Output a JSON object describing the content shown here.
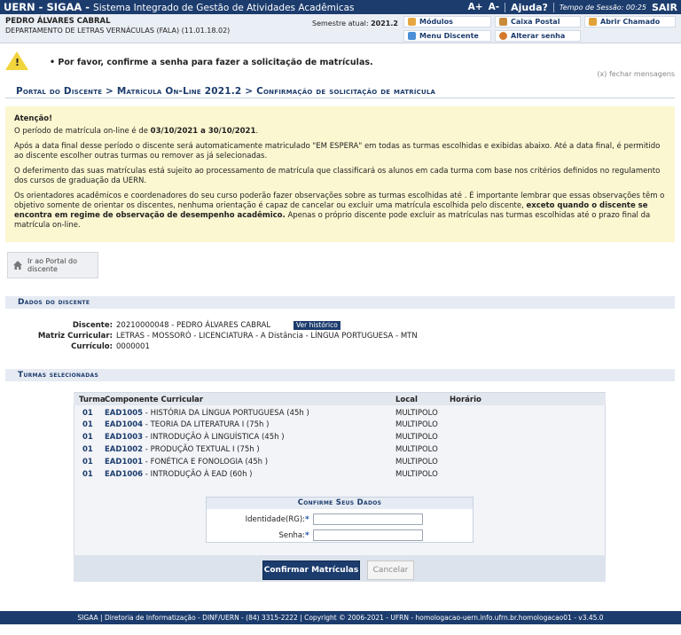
{
  "topbar": {
    "brand": "UERN - SIGAA -",
    "system_name": "Sistema Integrado de Gestão de Atividades Acadêmicas",
    "font_increase": "A+",
    "font_decrease": "A-",
    "help": "Ajuda?",
    "session_label": "Tempo de Sessão: 00:25",
    "logout": "SAIR"
  },
  "header": {
    "user_name": "PEDRO ÁLVARES CABRAL",
    "department": "DEPARTAMENTO DE LETRAS VERNÁCULAS (FALA) (11.01.18.02)",
    "semester_label": "Semestre atual:",
    "semester_value": "2021.2",
    "menu": {
      "modulos": "Módulos",
      "caixa_postal": "Caixa Postal",
      "abrir_chamado": "Abrir Chamado",
      "menu_discente": "Menu Discente",
      "alterar_senha": "Alterar senha"
    }
  },
  "message": {
    "text": "Por favor, confirme a senha para fazer a solicitação de matrículas.",
    "close": "(x) fechar mensagens"
  },
  "breadcrumb": "Portal do Discente > Matrícula On-Line 2021.2 > Confirmação de solicitação de matrícula",
  "attention": {
    "title": "Atenção!",
    "p1_prefix": "O período de matrícula on-line é de ",
    "p1_dates": "03/10/2021 a 30/10/2021",
    "p1_suffix": ".",
    "p2": "Após a data final desse período o discente será automaticamente matriculado \"EM ESPERA\" em todas as turmas escolhidas e exibidas abaixo. Até a data final, é permitido ao discente escolher outras turmas ou remover as já selecionadas.",
    "p3": "O deferimento das suas matrículas está sujeito ao processamento de matrícula que classificará os alunos em cada turma com base nos critérios definidos no regulamento dos cursos de graduação da UERN.",
    "p4_a": "Os orientadores acadêmicos e coordenadores do seu curso poderão fazer observações sobre as turmas escolhidas até . É importante lembrar que essas observações têm o objetivo somente de orientar os discentes, nenhuma orientação é capaz de cancelar ou excluir uma matrícula escolhida pelo discente, ",
    "p4_bold": "exceto quando o discente se encontra em regime de observação de desempenho acadêmico.",
    "p4_b": " Apenas o próprio discente pode excluir as matrículas nas turmas escolhidas até o prazo final da matrícula on-line."
  },
  "portal_button": {
    "line1": "Ir ao Portal do",
    "line2": "discente"
  },
  "dados": {
    "section_title": "Dados do discente",
    "discente_label": "Discente:",
    "discente_value": "20210000048 - PEDRO ÁLVARES CABRAL",
    "ver_historico": "Ver histórico",
    "matriz_label": "Matriz Curricular:",
    "matriz_value": "LETRAS - MOSSORÓ - LICENCIATURA - A Distância - LÍNGUA PORTUGUESA - MTN",
    "curriculo_label": "Currículo:",
    "curriculo_value": "0000001"
  },
  "turmas": {
    "section_title": "Turmas selecionadas",
    "headers": {
      "turma": "Turma",
      "componente": "Componente Curricular",
      "local": "Local",
      "horario": "Horário"
    },
    "rows": [
      {
        "turma": "01",
        "code": "EAD1005",
        "name": " - HISTÓRIA DA LÍNGUA PORTUGUESA (45h )",
        "local": "MULTIPOLO",
        "horario": ""
      },
      {
        "turma": "01",
        "code": "EAD1004",
        "name": " - TEORIA DA LITERATURA I (75h )",
        "local": "MULTIPOLO",
        "horario": ""
      },
      {
        "turma": "01",
        "code": "EAD1003",
        "name": " - INTRODUÇÃO À LINGUÍSTICA (45h )",
        "local": "MULTIPOLO",
        "horario": ""
      },
      {
        "turma": "01",
        "code": "EAD1002",
        "name": " - PRODUÇÃO TEXTUAL I (75h )",
        "local": "MULTIPOLO",
        "horario": ""
      },
      {
        "turma": "01",
        "code": "EAD1001",
        "name": " - FONÉTICA E FONOLOGIA (45h )",
        "local": "MULTIPOLO",
        "horario": ""
      },
      {
        "turma": "01",
        "code": "EAD1006",
        "name": " - INTRODUÇÃO À EAD (60h )",
        "local": "MULTIPOLO",
        "horario": ""
      }
    ]
  },
  "confirm": {
    "title": "Confirme Seus Dados",
    "identidade_label": "Identidade(RG):",
    "identidade_value": "",
    "senha_label": "Senha:",
    "senha_value": "",
    "required_mark": "*",
    "confirm_button": "Confirmar Matrículas",
    "cancel_button": "Cancelar"
  },
  "footer": "SIGAA | Diretoria de Informatização - DINF/UERN - (84) 3315-2222 | Copyright © 2006-2021 - UFRN - homologacao-uern.info.ufrn.br.homologacao01 - v3.45.0",
  "colors": {
    "primary": "#1c3c6d",
    "attention_bg": "#fbf7d1",
    "header_bg": "#eaeef5"
  }
}
